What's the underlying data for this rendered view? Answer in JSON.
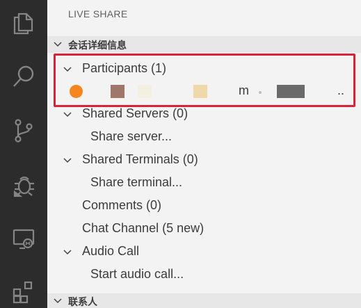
{
  "sidebar": {
    "title": "LIVE SHARE",
    "session_section": "会话详细信息",
    "contacts_section": "联系人"
  },
  "tree": {
    "participants": "Participants (1)",
    "participant_name_fragment": "m",
    "participant_trailing": "..",
    "shared_servers": "Shared Servers (0)",
    "share_server": "Share server...",
    "shared_terminals": "Shared Terminals (0)",
    "share_terminal": "Share terminal...",
    "comments": "Comments (0)",
    "chat_channel": "Chat Channel (5 new)",
    "audio_call": "Audio Call",
    "start_audio_call": "Start audio call..."
  },
  "activity_bar": {
    "items": [
      "files-icon",
      "search-icon",
      "source-control-icon",
      "debug-icon",
      "remote-explorer-icon",
      "extensions-icon"
    ]
  },
  "colors": {
    "activity_bar_bg": "#2c2c2c",
    "sidebar_bg": "#f3f3f3",
    "highlight": "#d8243a",
    "avatar": "#f5861f"
  }
}
